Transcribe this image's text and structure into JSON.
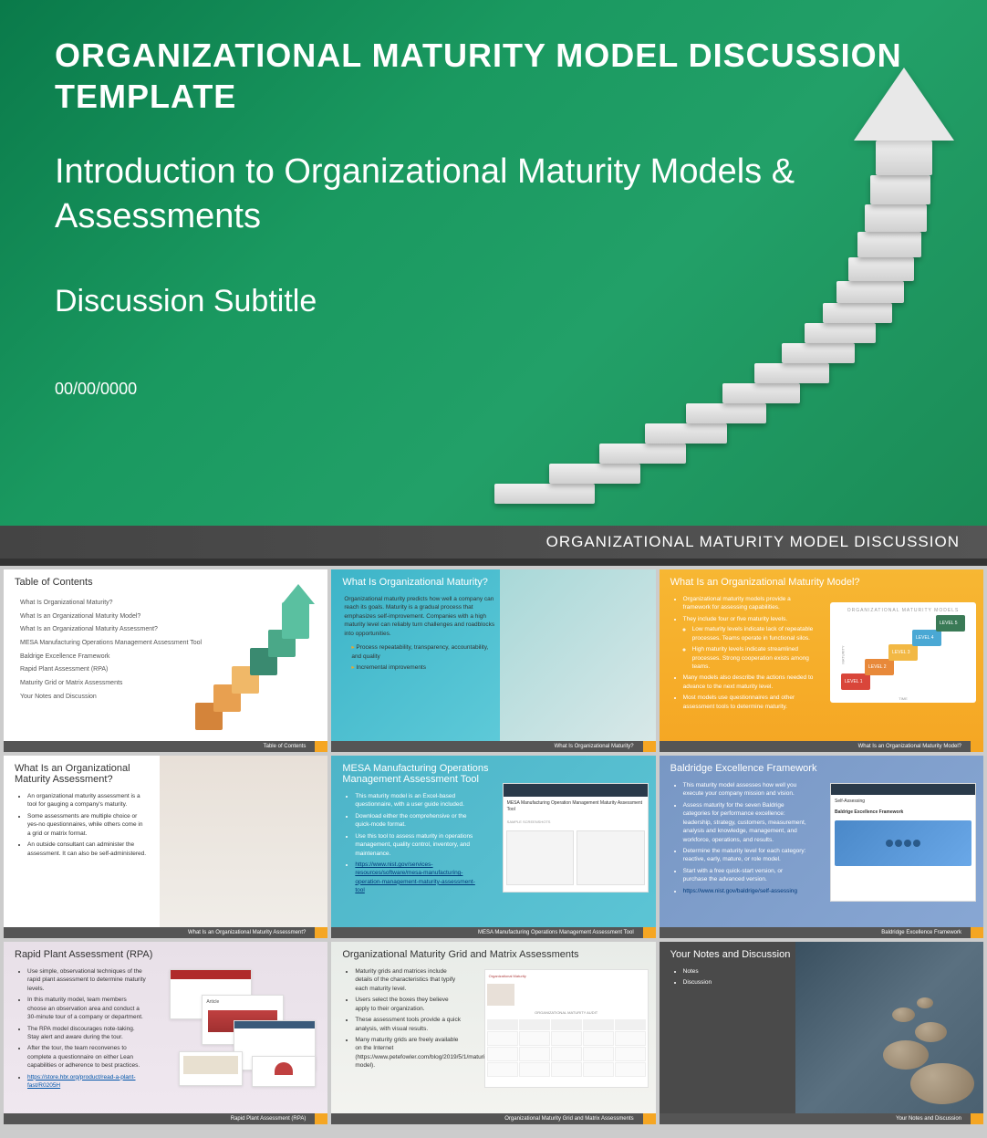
{
  "hero": {
    "title": "ORGANIZATIONAL MATURITY MODEL DISCUSSION TEMPLATE",
    "subtitle1": "Introduction to Organizational Maturity Models & Assessments",
    "subtitle2": "Discussion Subtitle",
    "date": "00/00/0000",
    "footer": "ORGANIZATIONAL MATURITY MODEL DISCUSSION"
  },
  "thumbs": {
    "toc": {
      "title": "Table of Contents",
      "items": [
        "What Is Organizational Maturity?",
        "What Is an Organizational Maturity Model?",
        "What Is an Organizational Maturity Assessment?",
        "MESA Manufacturing Operations Management Assessment Tool",
        "Baldrige Excellence Framework",
        "Rapid Plant Assessment (RPA)",
        "Maturity Grid or Matrix Assessments",
        "Your Notes and Discussion"
      ],
      "footer": "Table of Contents"
    },
    "t2": {
      "title": "What Is Organizational Maturity?",
      "intro": "Organizational maturity predicts how well a company can reach its goals. Maturity is a gradual process that emphasizes self-improvement. Companies with a high maturity level can reliably turn challenges and roadblocks into opportunities.",
      "bullets": [
        "Process repeatability, transparency, accountability, and quality",
        "Incremental improvements"
      ],
      "footer": "What Is Organizational Maturity?"
    },
    "t3": {
      "title": "What Is an Organizational Maturity Model?",
      "bullets": [
        "Organizational maturity models provide a framework for assessing capabilities.",
        "They include four or five maturity levels.",
        "Many models also describe the actions needed to advance to the next maturity level.",
        "Most models use questionnaires and other assessment tools to determine maturity."
      ],
      "sub_bullets": [
        "Low maturity levels indicate lack of repeatable processes. Teams operate in functional silos.",
        "High maturity levels indicate streamlined processes. Strong cooperation exists among teams."
      ],
      "chart_title": "ORGANIZATIONAL MATURITY MODELS",
      "levels": [
        "LEVEL 1",
        "LEVEL 2",
        "LEVEL 3",
        "LEVEL 4",
        "LEVEL 5"
      ],
      "axis_y": "MATURITY",
      "axis_x": "TIME",
      "footer": "What Is an Organizational Maturity Model?"
    },
    "t4": {
      "title": "What Is an Organizational Maturity Assessment?",
      "bullets": [
        "An organizational maturity assessment is a tool for gauging a company's maturity.",
        "Some assessments are multiple choice or yes-no questionnaires, while others come in a grid or matrix format.",
        "An outside consultant can administer the assessment. It can also be self-administered."
      ],
      "footer": "What Is an Organizational Maturity Assessment?"
    },
    "t5": {
      "title": "MESA Manufacturing Operations Management Assessment Tool",
      "bullets": [
        "This maturity model is an Excel-based questionnaire, with a user guide included.",
        "Download either the comprehensive or the quick-mode format.",
        "Use this tool to assess maturity in operations management, quality control, inventory, and maintenance."
      ],
      "link": "https://www.nist.gov/services-resources/software/mesa-manufacturing-operation-management-maturity-assessment-tool",
      "footer": "MESA Manufacturing Operations Management Assessment Tool"
    },
    "t6": {
      "title": "Baldridge Excellence Framework",
      "bullets": [
        "This maturity model assesses how well you execute your company mission and vision.",
        "Assess maturity for the seven Baldrige categories for performance excellence: leadership, strategy, customers, measurement, analysis and knowledge, management, and workforce, operations, and results.",
        "Determine the maturity level for each category: reactive, early, mature, or role model.",
        "Start with a free quick-start version, or purchase the advanced version."
      ],
      "link": "https://www.nist.gov/baldrige/self-assessing",
      "footer": "Baldridge Excellence Framework"
    },
    "t7": {
      "title": "Rapid Plant Assessment (RPA)",
      "bullets": [
        "Use simple, observational techniques of the rapid plant assessment to determine maturity levels.",
        "In this maturity model, team members choose an observation area and conduct a 30-minute tour of a company or department.",
        "The RPA model discourages note-taking. Stay alert and aware during the tour.",
        "After the tour, the team reconvenes to complete a questionnaire on either Lean capabilities or adherence to best practices."
      ],
      "link": "https://store.hbr.org/product/read-a-plant-fast/R0205H",
      "card_label": "Article",
      "footer": "Rapid Plant Assessment (RPA)"
    },
    "t8": {
      "title": "Organizational Maturity Grid and Matrix Assessments",
      "bullets": [
        "Maturity grids and matrices include details of the characteristics that typify each maturity level.",
        "Users select the boxes they believe apply to their organization.",
        "These assessment tools provide a quick analysis, with visual results.",
        "Many maturity grids are freely available on the Internet (https://www.petefowler.com/blog/2019/5/1/maturity-model)."
      ],
      "footer": "Organizational Maturity Grid and Matrix Assessments"
    },
    "t9": {
      "title": "Your Notes and Discussion",
      "bullets": [
        "Notes",
        "Discussion"
      ],
      "footer": "Your Notes and Discussion"
    }
  }
}
